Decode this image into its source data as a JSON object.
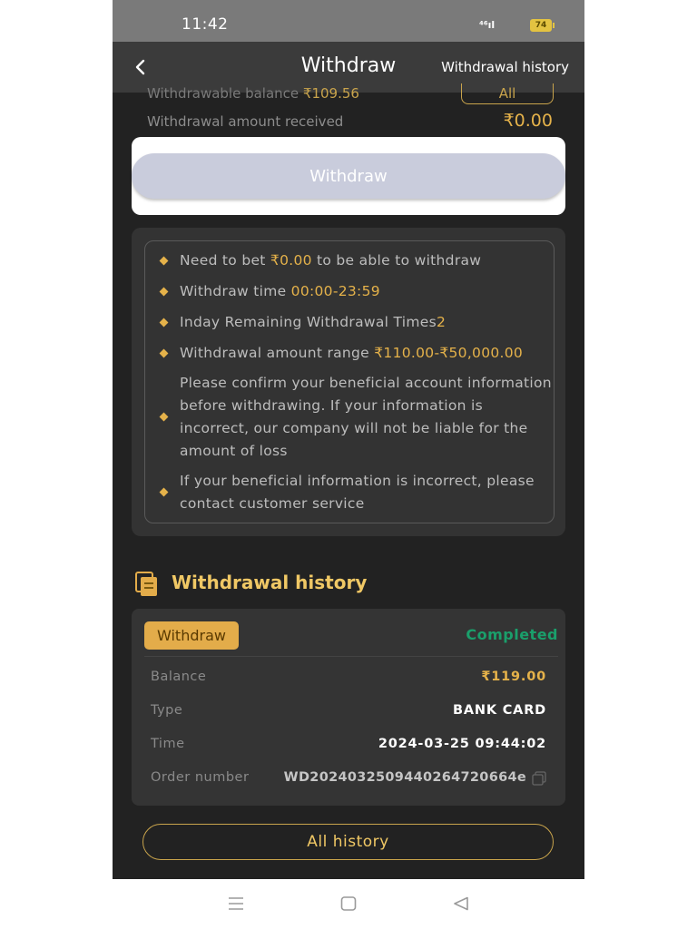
{
  "status_bar": {
    "time": "11:42",
    "signal_text": "⁴⁶ıl",
    "battery": "74"
  },
  "header": {
    "title": "Withdraw",
    "history_link": "Withdrawal history",
    "back_icon": "chevron-left-icon"
  },
  "balance": {
    "withdrawable_label": "Withdrawable balance ",
    "withdrawable_amount": "₹109.56",
    "all_label": "All",
    "received_label": "Withdrawal amount received",
    "received_amount": "₹0.00"
  },
  "withdraw_button": "Withdraw",
  "rules": {
    "r1_a": "Need to bet ",
    "r1_b": "₹0.00",
    "r1_c": " to be able to withdraw",
    "r2_a": "Withdraw time ",
    "r2_b": "00:00-23:59",
    "r3_a": "Inday Remaining Withdrawal Times",
    "r3_b": "2",
    "r4_a": "Withdrawal amount range ",
    "r4_b": "₹110.00-₹50,000.00",
    "r5": "Please confirm your beneficial account information before withdrawing. If your information is incorrect, our company will not be liable for the amount of loss",
    "r6": "If your beneficial information is incorrect, please contact customer service"
  },
  "history": {
    "title": "Withdrawal history",
    "record": {
      "tag": "Withdraw",
      "status": "Completed",
      "balance_label": "Balance",
      "balance_value": "₹119.00",
      "type_label": "Type",
      "type_value": "BANK CARD",
      "time_label": "Time",
      "time_value": "2024-03-25 09:44:02",
      "order_label": "Order number",
      "order_value": "WD2024032509440264720664e"
    },
    "all_history": "All history"
  },
  "colors": {
    "gold": "#e5b24a",
    "status_green": "#1a9f6b",
    "background": "#222222"
  }
}
